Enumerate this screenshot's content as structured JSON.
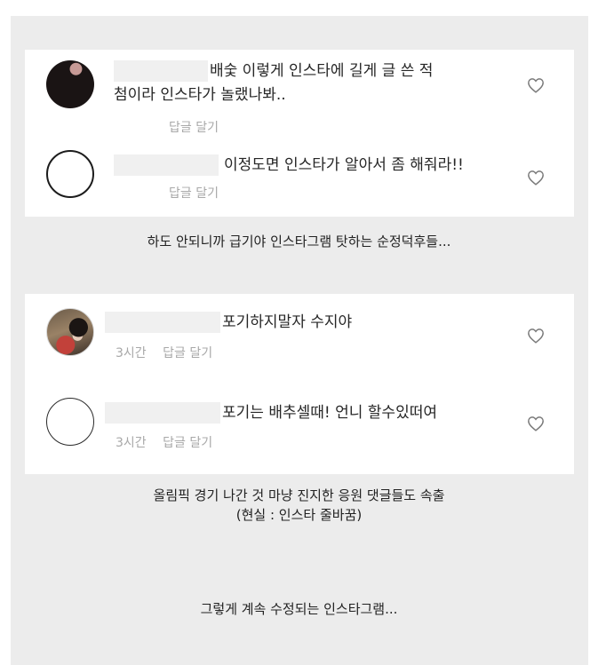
{
  "section1": {
    "comments": [
      {
        "text_line1": "배숯 이렇게 인스타에 길게 글 쓴 적",
        "text_line2": "첨이라 인스타가 놀랬나봐..",
        "reply": "답글 달기"
      },
      {
        "text_line1": "이정도면 인스타가 알아서 좀 해줘라!!",
        "reply": "답글 달기"
      }
    ],
    "caption": "하도 안되니까 급기야 인스타그램 탓하는 순정덕후들..."
  },
  "section2": {
    "comments": [
      {
        "text_line1": "포기하지말자 수지야",
        "time": "3시간",
        "reply": "답글 달기"
      },
      {
        "text_line1": "포기는 배추셀때! 언니 할수있떠여",
        "time": "3시간",
        "reply": "답글 달기"
      }
    ],
    "caption_line1": "올림픽 경기 나간 것 마냥 진지한 응원 댓글들도 속출",
    "caption_line2": "(현실 : 인스타 줄바꿈)"
  },
  "section3": {
    "caption": "그렇게 계속 수정되는 인스타그램..."
  },
  "icons": {
    "like": "heart-outline-icon"
  }
}
